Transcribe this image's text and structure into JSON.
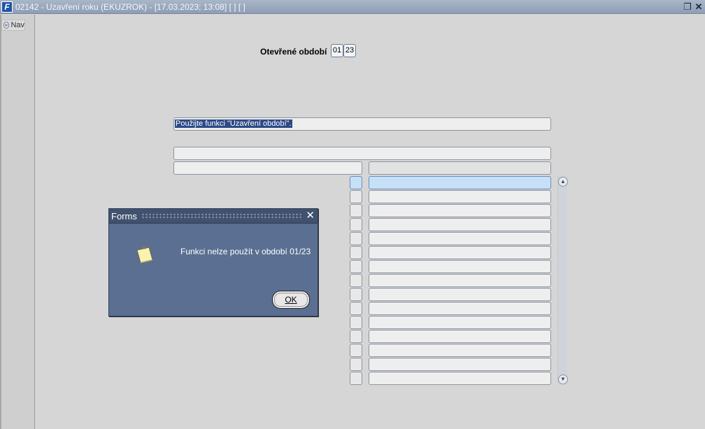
{
  "window": {
    "title": "02142 - Uzavření roku (EKUZROK) - [17.03.2023; 13:08]  [ ]  [ ]",
    "restore_icon": "restore-icon",
    "close_icon": "close-icon"
  },
  "leftbar": {
    "nav_label": "Nav"
  },
  "period": {
    "label": "Otevřené období",
    "month": "01",
    "year": "23"
  },
  "info_field": {
    "value": "Použijte funkci \"Uzavření období\"."
  },
  "dialog": {
    "title": "Forms",
    "message": "Funkci nelze použít v období 01/23",
    "ok_label": "OK"
  },
  "list": {
    "row_count": 15
  }
}
